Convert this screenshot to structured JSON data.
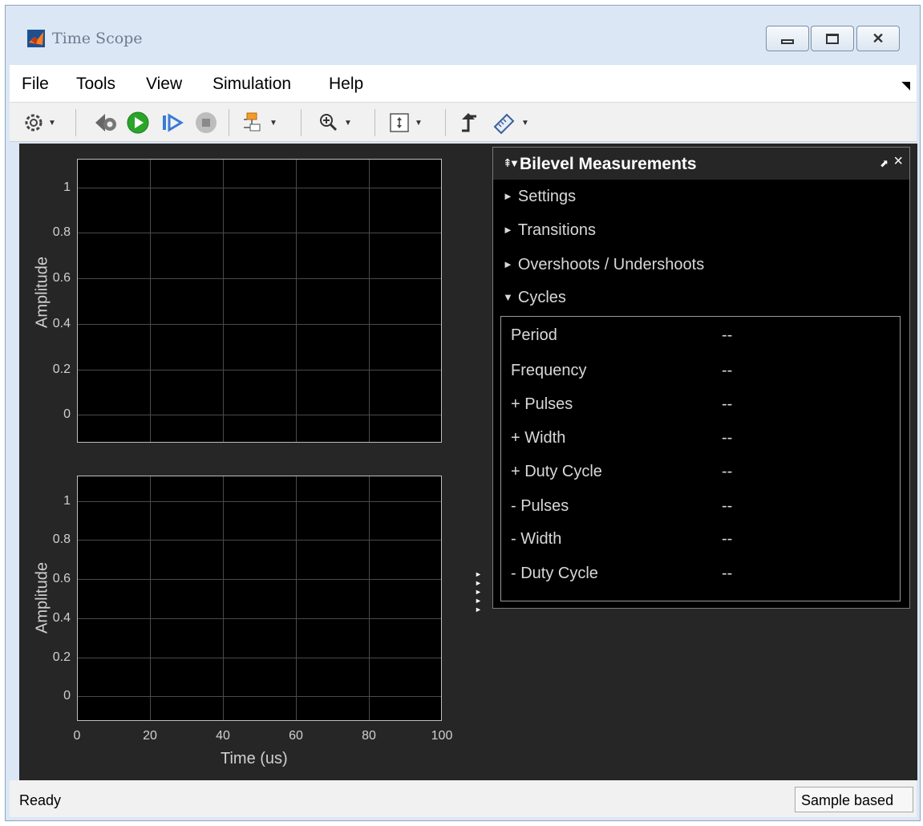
{
  "window": {
    "title": "Time Scope",
    "controls": {
      "minimize": "minimize",
      "restore": "restore",
      "close": "close"
    }
  },
  "menu": {
    "items": [
      "File",
      "Tools",
      "View",
      "Simulation",
      "Help"
    ]
  },
  "toolbar": {
    "icons": [
      "settings-icon",
      "step-back-icon",
      "run-icon",
      "step-forward-icon",
      "stop-icon",
      "signal-selection-icon",
      "zoom-in-icon",
      "scale-axes-icon",
      "triggers-icon",
      "measurements-icon"
    ]
  },
  "plots": {
    "top": {
      "ylabel": "Amplitude",
      "yticks": [
        "1",
        "0.8",
        "0.6",
        "0.4",
        "0.2",
        "0"
      ]
    },
    "bottom": {
      "ylabel": "Amplitude",
      "yticks": [
        "1",
        "0.8",
        "0.6",
        "0.4",
        "0.2",
        "0"
      ],
      "xticks": [
        "0",
        "20",
        "40",
        "60",
        "80",
        "100"
      ],
      "xlabel": "Time (us)"
    }
  },
  "panel": {
    "title": "Bilevel Measurements",
    "sections": [
      "Settings",
      "Transitions",
      "Overshoots / Undershoots",
      "Cycles"
    ],
    "cycles": [
      {
        "label": "Period",
        "value": "--"
      },
      {
        "label": "Frequency",
        "value": "--"
      },
      {
        "label": "+ Pulses",
        "value": "--"
      },
      {
        "label": "+ Width",
        "value": "--"
      },
      {
        "label": "+ Duty Cycle",
        "value": "--"
      },
      {
        "label": "- Pulses",
        "value": "--"
      },
      {
        "label": "- Width",
        "value": "--"
      },
      {
        "label": "- Duty Cycle",
        "value": "--"
      }
    ]
  },
  "status": {
    "text": "Ready",
    "mode": "Sample based"
  },
  "colors": {
    "plot_background": "#000000",
    "figure_background": "#262626",
    "grid": "#4a4a4a",
    "chrome": "#dbe7f4"
  }
}
